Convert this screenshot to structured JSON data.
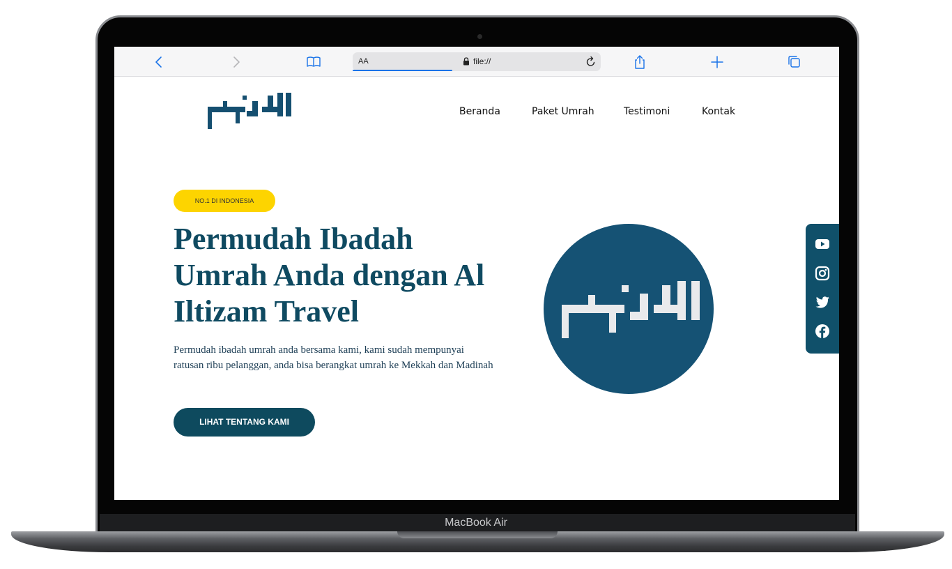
{
  "device": {
    "label": "MacBook Air"
  },
  "browser": {
    "text_size_label": "AA",
    "url": "file://"
  },
  "site": {
    "logo_alt": "الالتزام",
    "nav": [
      "Beranda",
      "Paket Umrah",
      "Testimoni",
      "Kontak"
    ],
    "hero": {
      "badge": "NO.1 DI INDONESIA",
      "title": "Permudah Ibadah Umrah Anda dengan Al Iltizam Travel",
      "description": "Permudah ibadah umrah anda bersama kami, kami sudah mempunyai ratusan ribu pelanggan, anda bisa berangkat umrah ke Mekkah dan Madinah",
      "cta": "LIHAT TENTANG KAMI"
    },
    "social": [
      "youtube-icon",
      "instagram-icon",
      "twitter-icon",
      "facebook-icon"
    ]
  },
  "colors": {
    "brand": "#0f4a61",
    "badge": "#fdd400",
    "social_bg": "#10506a"
  }
}
